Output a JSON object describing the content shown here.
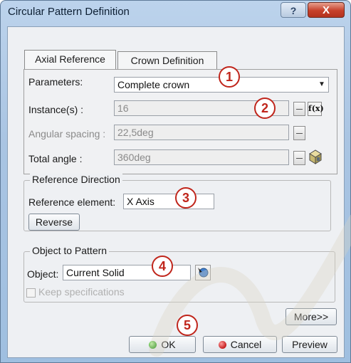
{
  "window": {
    "title": "Circular Pattern Definition",
    "help_label": "?",
    "close_label": "X"
  },
  "tabs": [
    {
      "label": "Axial Reference"
    },
    {
      "label": "Crown Definition"
    }
  ],
  "parameters": {
    "label": "Parameters:",
    "value": "Complete crown",
    "instances_label": "Instance(s) :",
    "instances_value": "16",
    "fx_label": "f(x)",
    "angular_label": "Angular spacing :",
    "angular_value": "22,5deg",
    "total_label": "Total angle :",
    "total_value": "360deg"
  },
  "reference": {
    "title": "Reference Direction",
    "element_label": "Reference element:",
    "element_value": "X Axis",
    "reverse_label": "Reverse"
  },
  "object": {
    "title": "Object to Pattern",
    "label": "Object:",
    "value": "Current Solid",
    "keep_label": "Keep specifications"
  },
  "buttons": {
    "more": "More>>",
    "ok": "OK",
    "cancel": "Cancel",
    "preview": "Preview"
  },
  "callouts": [
    "1",
    "2",
    "3",
    "4",
    "5"
  ],
  "icons": {
    "help": "question-icon",
    "close": "close-icon",
    "fx": "formula-icon",
    "cube": "geometry-cube-icon",
    "select": "selection-icon"
  },
  "colors": {
    "callout": "#c0251b",
    "ok_dot": "#2e9b1c",
    "cancel_dot": "#c41d1d"
  }
}
